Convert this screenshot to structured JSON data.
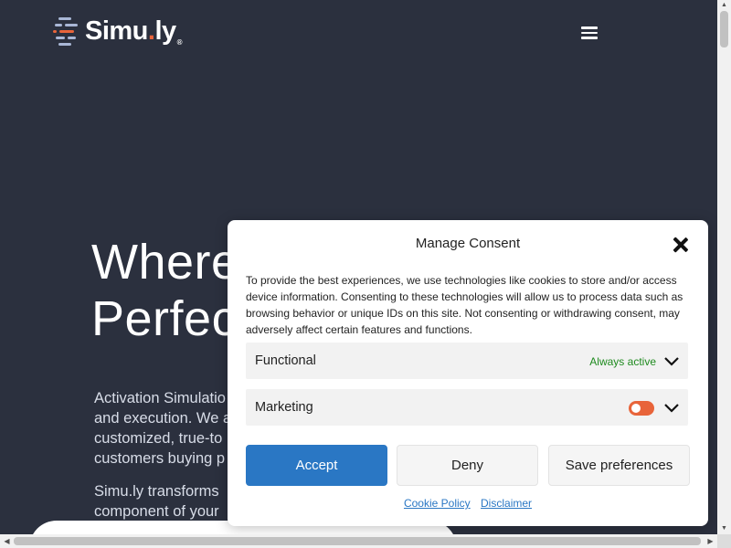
{
  "header": {
    "logo_text_main": "Simu",
    "logo_text_dot": ".",
    "logo_text_end": "ly",
    "logo_reg": "®",
    "menu_icon": "hamburger-menu-icon"
  },
  "hero": {
    "title_line1": "Where",
    "title_line2": "Perfec",
    "p1": "Activation Simulatio and execution. We a customized, true-to customers buying p",
    "p2": "Simu.ly transforms component of your"
  },
  "consent": {
    "title": "Manage Consent",
    "close_icon": "close-icon",
    "description": "To provide the best experiences, we use technologies like cookies to store and/or access device information. Consenting to these technologies will allow us to process data such as browsing behavior or unique IDs on this site. Not consenting or withdrawing consent, may adversely affect certain features and functions.",
    "categories": [
      {
        "label": "Functional",
        "status": "Always active"
      },
      {
        "label": "Marketing",
        "toggle_on": true
      }
    ],
    "buttons": {
      "accept": "Accept",
      "deny": "Deny",
      "save": "Save preferences"
    },
    "links": {
      "cookie_policy": "Cookie Policy",
      "disclaimer": "Disclaimer"
    }
  },
  "colors": {
    "background": "#2b303e",
    "accent_orange": "#e8643a",
    "accept_blue": "#2a77c4",
    "active_green": "#1e8a1e"
  }
}
